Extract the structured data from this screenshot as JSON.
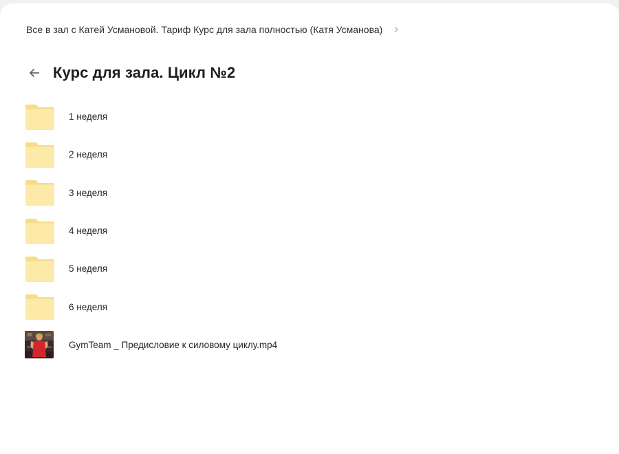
{
  "breadcrumb": {
    "parent_label": "Все в зал с Катей Усмановой. Тариф Курс для зала полностью (Катя Усманова)"
  },
  "header": {
    "title": "Курс для зала. Цикл №2"
  },
  "items": [
    {
      "type": "folder",
      "label": "1 неделя",
      "icon": "folder-icon"
    },
    {
      "type": "folder",
      "label": "2 неделя",
      "icon": "folder-icon"
    },
    {
      "type": "folder",
      "label": "3 неделя",
      "icon": "folder-icon"
    },
    {
      "type": "folder",
      "label": "4 неделя",
      "icon": "folder-icon"
    },
    {
      "type": "folder",
      "label": "5 неделя",
      "icon": "folder-icon"
    },
    {
      "type": "folder",
      "label": "6 неделя",
      "icon": "folder-icon"
    },
    {
      "type": "video",
      "label": "GymTeam _ Предисловие к силовому циклу.mp4",
      "icon": "video-thumbnail"
    }
  ],
  "colors": {
    "folder_back": "#f7dc8a",
    "folder_front": "#fde9a8",
    "chrome_background": "#f1f1f1",
    "panel_background": "#ffffff"
  }
}
